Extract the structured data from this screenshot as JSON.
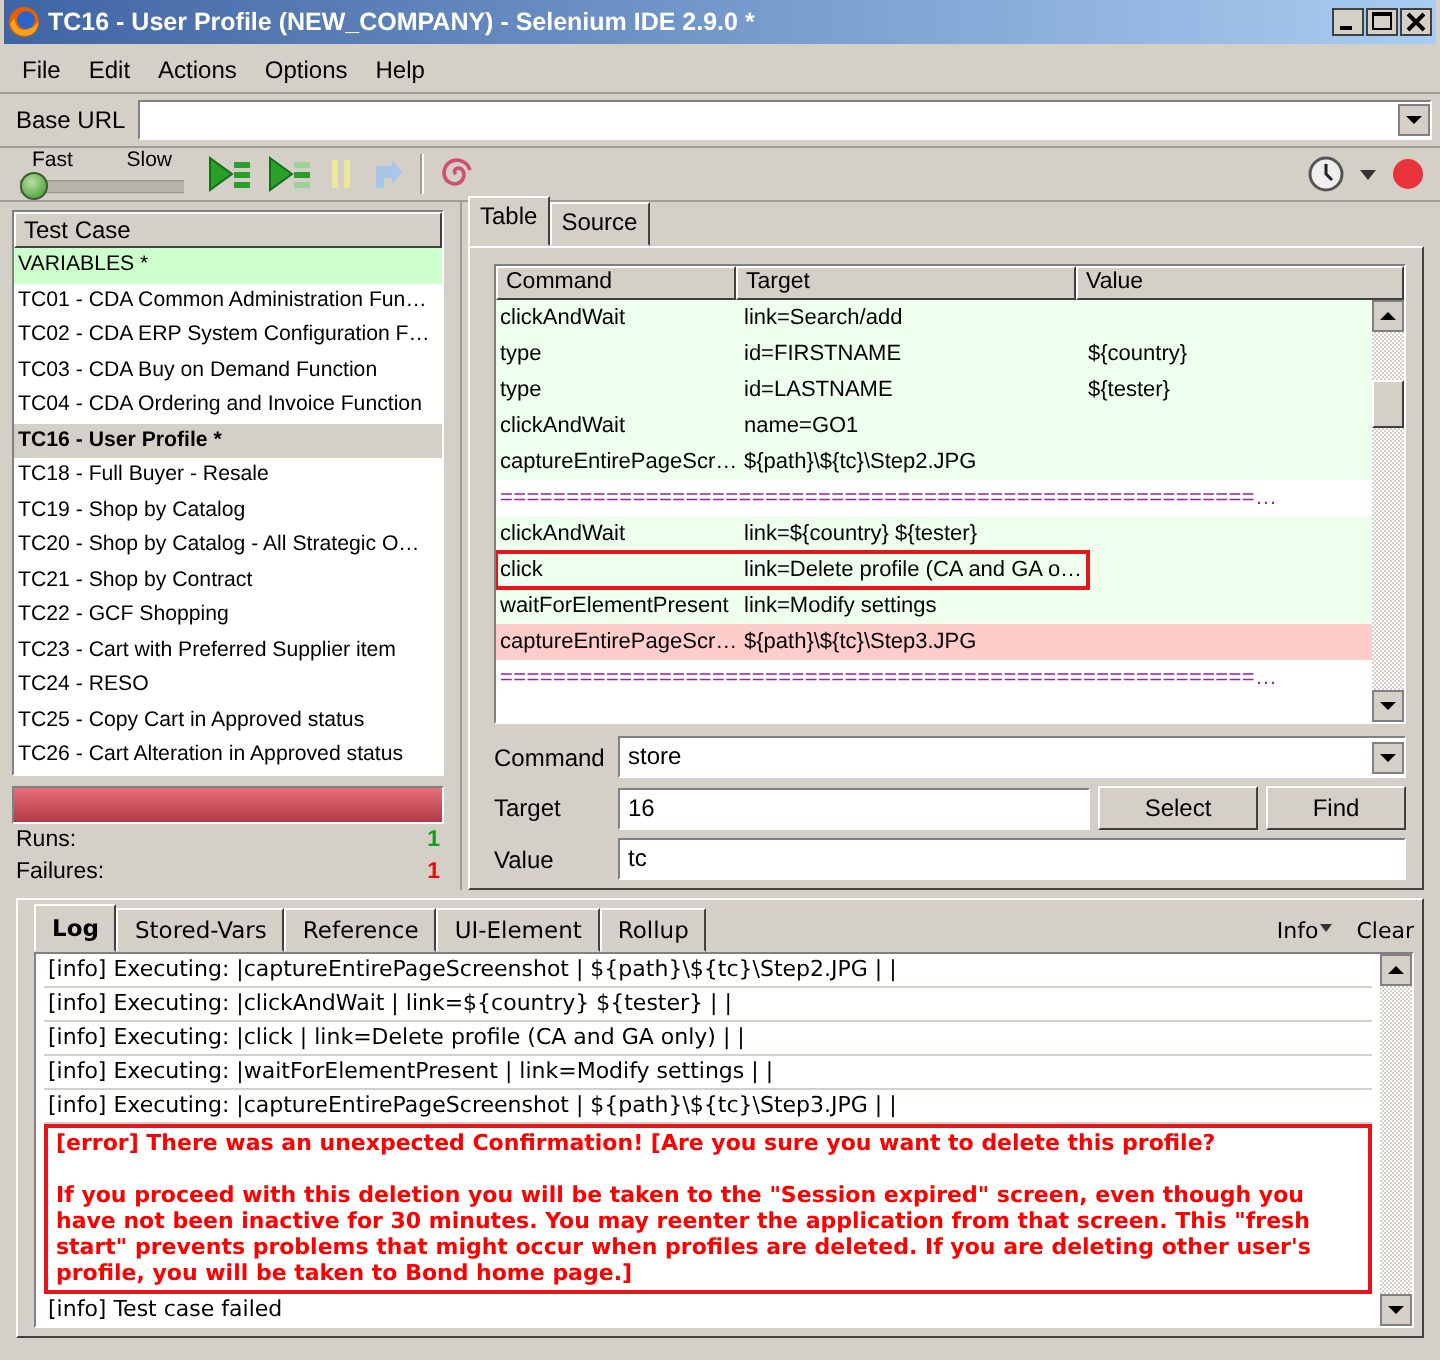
{
  "window": {
    "title": "TC16 - User Profile (NEW_COMPANY) - Selenium IDE 2.9.0 *"
  },
  "menu": [
    "File",
    "Edit",
    "Actions",
    "Options",
    "Help"
  ],
  "base_url": {
    "label": "Base URL"
  },
  "toolbar": {
    "fast_label": "Fast",
    "slow_label": "Slow",
    "speed": {
      "level": 0
    },
    "pause_disabled": true,
    "step_disabled": true
  },
  "test_cases": {
    "header": "Test Case",
    "items": [
      {
        "label": "VARIABLES *",
        "passed": true,
        "selected": false
      },
      {
        "label": "TC01 - CDA Common Administration Fun…",
        "passed": false,
        "selected": false
      },
      {
        "label": "TC02 - CDA ERP System Configuration F…",
        "passed": false,
        "selected": false
      },
      {
        "label": "TC03 - CDA Buy on Demand Function",
        "passed": false,
        "selected": false
      },
      {
        "label": "TC04 - CDA Ordering and Invoice Function",
        "passed": false,
        "selected": false
      },
      {
        "label": "TC16 - User Profile *",
        "passed": false,
        "selected": true
      },
      {
        "label": "TC18 - Full Buyer - Resale",
        "passed": false,
        "selected": false
      },
      {
        "label": "TC19 - Shop by Catalog",
        "passed": false,
        "selected": false
      },
      {
        "label": "TC20 - Shop by Catalog - All Strategic O…",
        "passed": false,
        "selected": false
      },
      {
        "label": "TC21 - Shop by Contract",
        "passed": false,
        "selected": false
      },
      {
        "label": "TC22 - GCF Shopping",
        "passed": false,
        "selected": false
      },
      {
        "label": "TC23 - Cart with Preferred Supplier item",
        "passed": false,
        "selected": false
      },
      {
        "label": "TC24 - RESO",
        "passed": false,
        "selected": false
      },
      {
        "label": "TC25 - Copy Cart in Approved status",
        "passed": false,
        "selected": false
      },
      {
        "label": "TC26 - Cart Alteration in Approved status",
        "passed": false,
        "selected": false
      }
    ],
    "progress": {
      "level": 1,
      "failed": true
    },
    "runs_label": "Runs:",
    "runs": "1",
    "failures_label": "Failures:",
    "failures": "1"
  },
  "editor": {
    "tabs": [
      {
        "label": "Table",
        "selected": true
      },
      {
        "label": "Source",
        "selected": false
      }
    ],
    "columns": [
      "Command",
      "Target",
      "Value"
    ],
    "rows": [
      {
        "kind": "command",
        "command": "clickAndWait",
        "target": "link=Search/add",
        "passed": true,
        "failed": false,
        "highlighted": false
      },
      {
        "kind": "command",
        "command": "type",
        "target": "id=FIRSTNAME",
        "value": "${country}",
        "passed": true,
        "failed": false,
        "highlighted": false
      },
      {
        "kind": "command",
        "command": "type",
        "target": "id=LASTNAME",
        "value": "${tester}",
        "passed": true,
        "failed": false,
        "highlighted": false
      },
      {
        "kind": "command",
        "command": "clickAndWait",
        "target": "name=GO1",
        "passed": true,
        "failed": false,
        "highlighted": false
      },
      {
        "kind": "command",
        "command": "captureEntirePageScr…",
        "target": "${path}\\${tc}\\Step2.JPG",
        "passed": true,
        "failed": false,
        "highlighted": false
      },
      {
        "kind": "comment",
        "text": "=========================================================…",
        "passed": false,
        "failed": false
      },
      {
        "kind": "command",
        "command": "clickAndWait",
        "target": "link=${country} ${tester}",
        "passed": true,
        "failed": false,
        "highlighted": false
      },
      {
        "kind": "command",
        "command": "click",
        "target": "link=Delete profile (CA and GA o…",
        "passed": true,
        "failed": false,
        "highlighted": true
      },
      {
        "kind": "command",
        "command": "waitForElementPresent",
        "target": "link=Modify settings",
        "passed": true,
        "failed": false,
        "highlighted": false
      },
      {
        "kind": "command",
        "command": "captureEntirePageScr…",
        "target": "${path}\\${tc}\\Step3.JPG",
        "passed": false,
        "failed": true,
        "highlighted": false
      },
      {
        "kind": "comment",
        "text": "=========================================================…",
        "passed": false,
        "failed": false
      }
    ],
    "command": {
      "label": "Command",
      "value": "store"
    },
    "target": {
      "label": "Target",
      "value": "16"
    },
    "value": {
      "label": "Value",
      "value": "tc"
    },
    "buttons": [
      "Select",
      "Find"
    ]
  },
  "log": {
    "tabs": [
      {
        "label": "Log",
        "selected": true
      },
      {
        "label": "Stored-Vars",
        "selected": false
      },
      {
        "label": "Reference",
        "selected": false
      },
      {
        "label": "UI-Element",
        "selected": false
      },
      {
        "label": "Rollup",
        "selected": false
      }
    ],
    "info_menu": "Info",
    "clear": "Clear",
    "entries": [
      {
        "kind": "info",
        "text": "[info] Executing: |captureEntirePageScreenshot | ${path}\\${tc}\\Step2.JPG | |",
        "highlighted": false
      },
      {
        "kind": "info",
        "text": "[info] Executing: |clickAndWait | link=${country} ${tester} | |",
        "highlighted": false
      },
      {
        "kind": "info",
        "text": "[info] Executing: |click | link=Delete profile (CA and GA only) | |",
        "highlighted": false
      },
      {
        "kind": "info",
        "text": "[info] Executing: |waitForElementPresent | link=Modify settings | |",
        "highlighted": false
      },
      {
        "kind": "info",
        "text": "[info] Executing: |captureEntirePageScreenshot | ${path}\\${tc}\\Step3.JPG | |",
        "highlighted": false
      },
      {
        "kind": "error",
        "text": "[error] There was an unexpected Confirmation! [Are you sure you want to delete this profile?\n\nIf you proceed with this deletion you will be taken to the \"Session expired\" screen, even though you have not been inactive for 30 minutes. You may reenter the application from that screen. This \"fresh start\" prevents problems that might occur when profiles are deleted. If you are deleting other user's profile, you will be taken to Bond home page.]",
        "highlighted": true
      },
      {
        "kind": "info",
        "text": "[info] Test case failed",
        "highlighted": false
      }
    ]
  }
}
